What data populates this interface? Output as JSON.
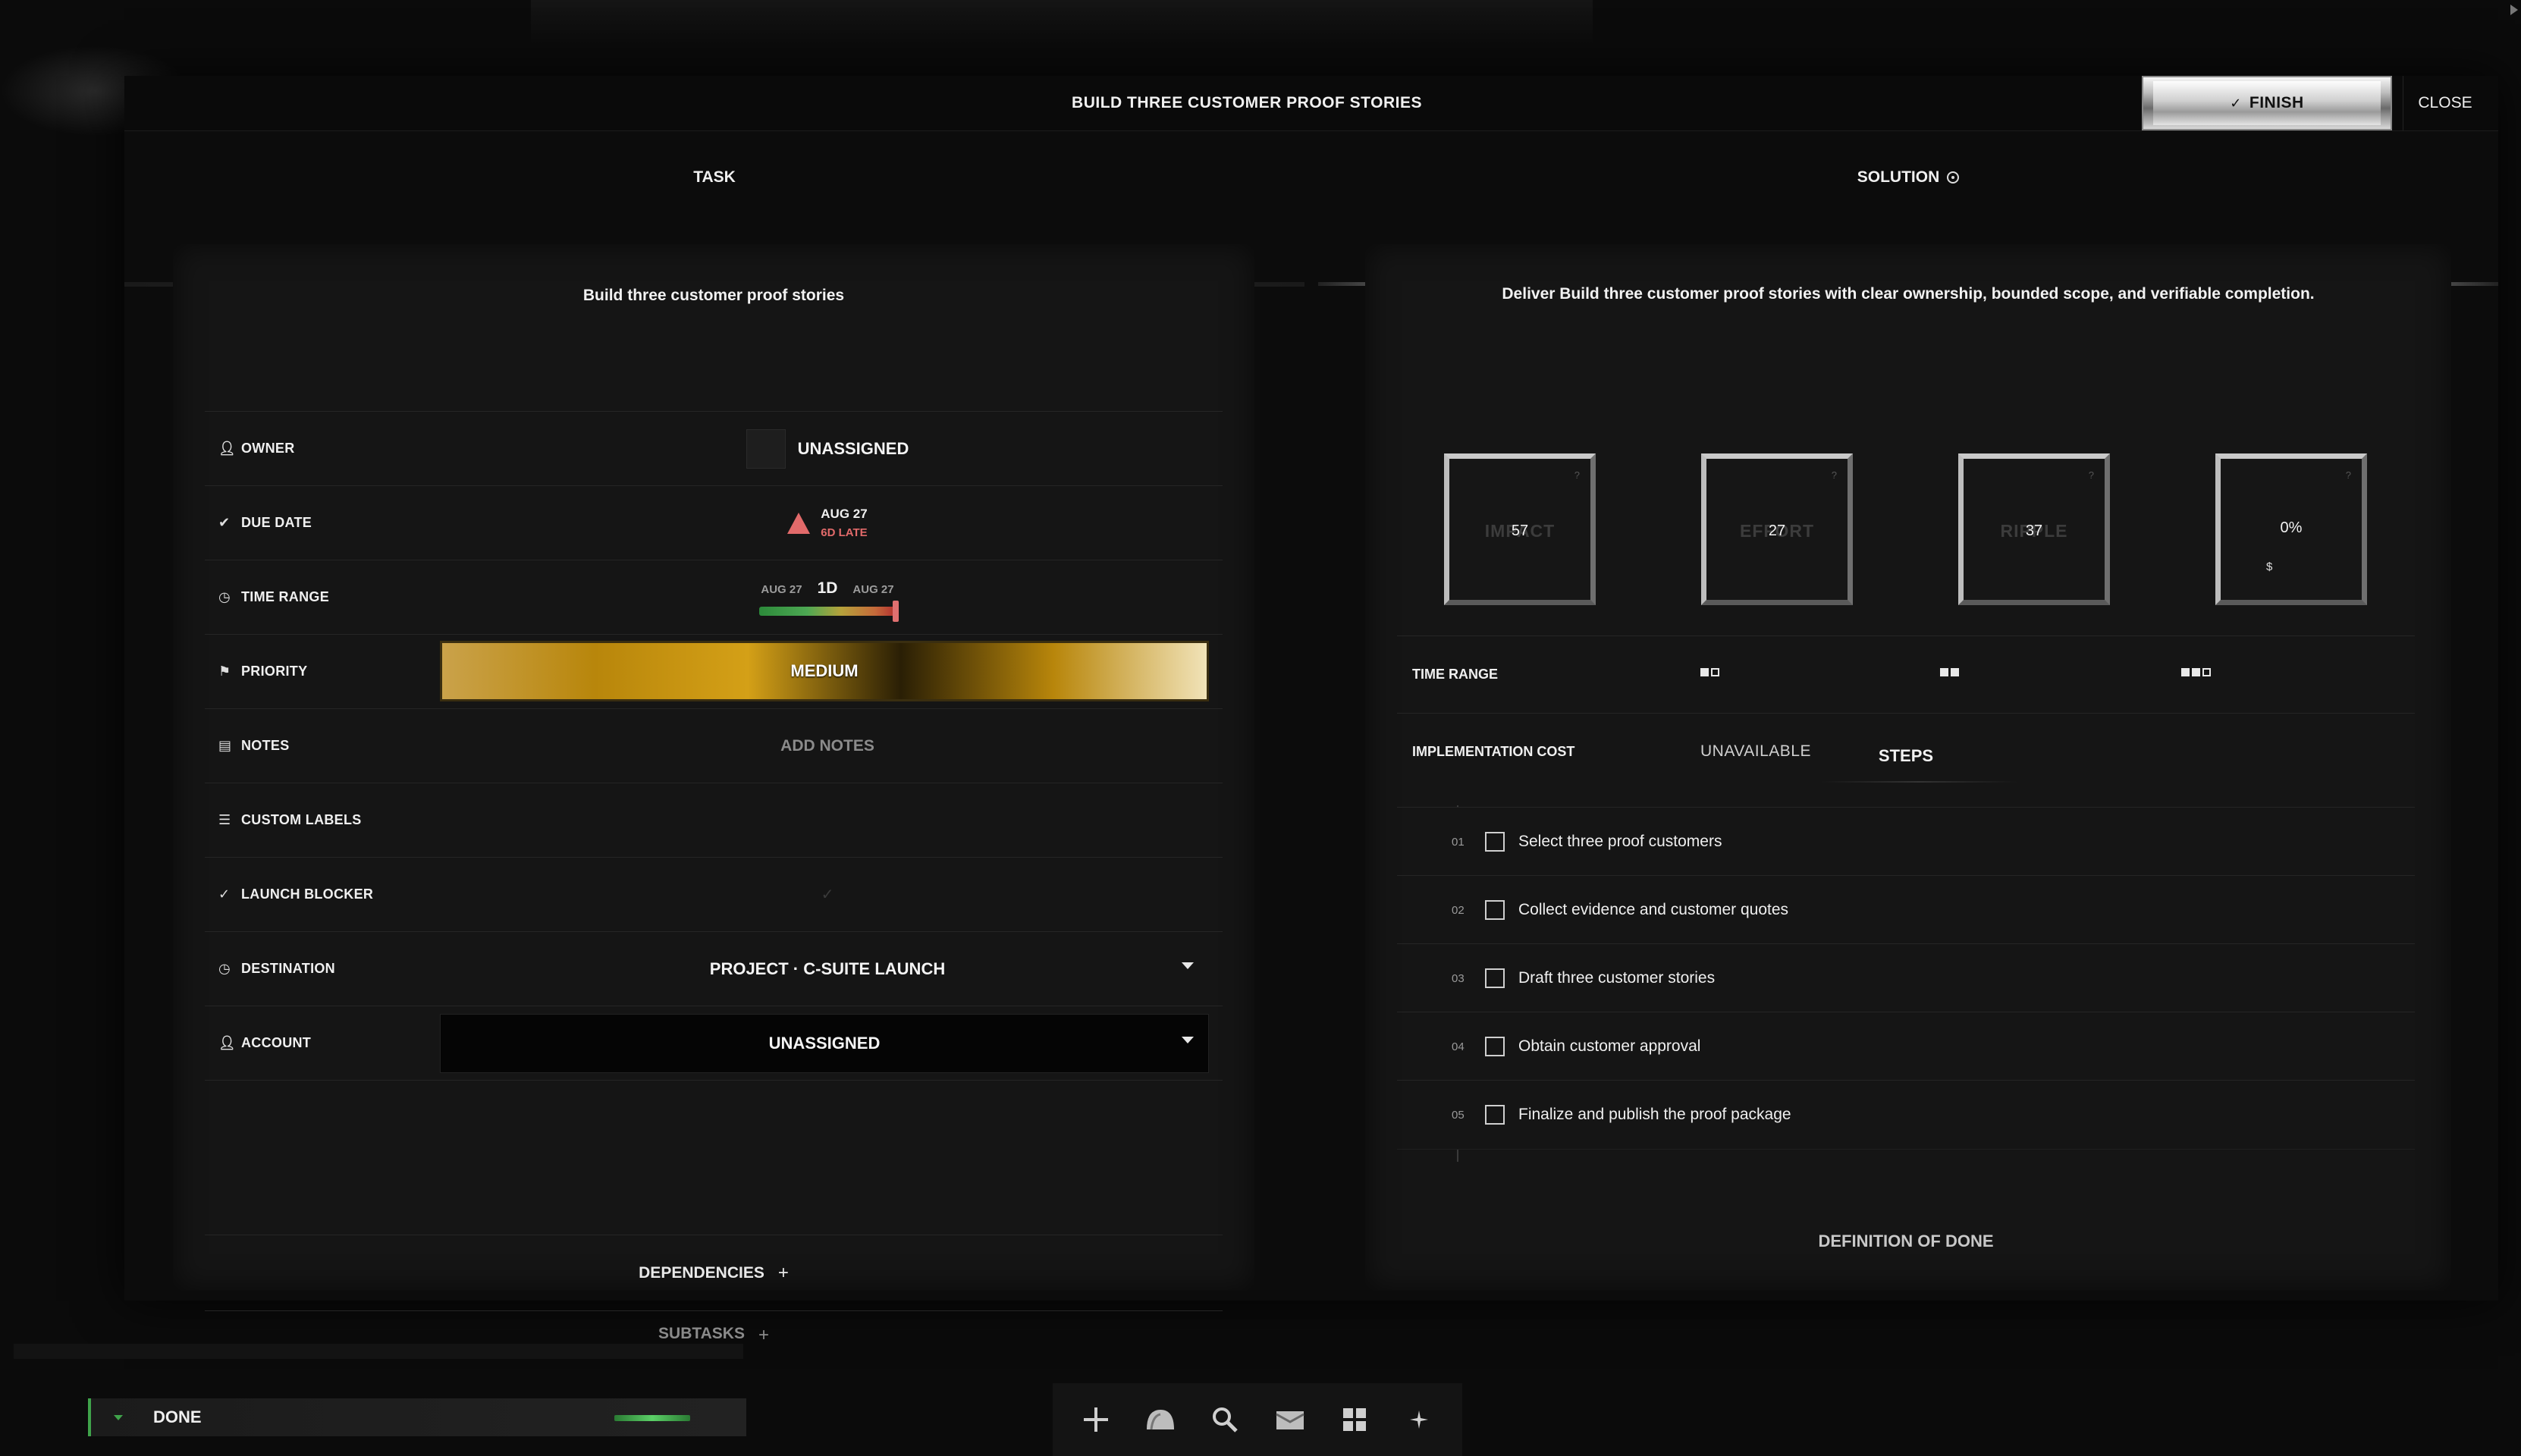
{
  "modal": {
    "title": "BUILD THREE CUSTOMER PROOF STORIES",
    "finish_label": "FINISH",
    "close_label": "CLOSE"
  },
  "tabs": {
    "task": "TASK",
    "solution": "SOLUTION"
  },
  "task": {
    "heading": "Build three customer proof stories",
    "rows": {
      "owner": {
        "label": "OWNER",
        "value": "UNASSIGNED"
      },
      "due_date": {
        "label": "DUE DATE",
        "date": "AUG 27",
        "status": "6D LATE"
      },
      "time_range": {
        "label": "TIME RANGE",
        "start": "AUG 27",
        "duration": "1D",
        "end": "AUG 27"
      },
      "priority": {
        "label": "PRIORITY",
        "value": "MEDIUM"
      },
      "notes": {
        "label": "NOTES",
        "value": "ADD NOTES"
      },
      "custom_labels": {
        "label": "CUSTOM LABELS"
      },
      "launch_blocker": {
        "label": "LAUNCH BLOCKER",
        "value": "✓"
      },
      "destination": {
        "label": "DESTINATION",
        "value": "PROJECT · C-SUITE LAUNCH"
      },
      "account": {
        "label": "ACCOUNT",
        "value": "UNASSIGNED"
      }
    },
    "dependencies_label": "DEPENDENCIES",
    "subtasks_label": "SUBTASKS"
  },
  "solution": {
    "heading": "Deliver Build three customer proof stories with clear ownership, bounded scope, and verifiable completion.",
    "metrics": [
      {
        "ghost": "IMPACT",
        "value": "57"
      },
      {
        "ghost": "EFFORT",
        "value": "27"
      },
      {
        "ghost": "RIPPLE",
        "value": "37"
      },
      {
        "ghost": "",
        "value": "0%",
        "sub": "$"
      }
    ],
    "time_range_label": "TIME RANGE",
    "implementation_cost_label": "IMPLEMENTATION COST",
    "implementation_cost_value": "UNAVAILABLE",
    "steps_label": "STEPS",
    "steps": [
      {
        "num": "01",
        "text": "Select three proof customers"
      },
      {
        "num": "02",
        "text": "Collect evidence and customer quotes"
      },
      {
        "num": "03",
        "text": "Draft three customer stories"
      },
      {
        "num": "04",
        "text": "Obtain customer approval"
      },
      {
        "num": "05",
        "text": "Finalize and publish the proof package"
      }
    ],
    "definition_of_done_label": "DEFINITION OF DONE"
  },
  "bottom": {
    "done_label": "DONE"
  },
  "icons": {
    "dock": [
      "plus-icon",
      "dome-icon",
      "search-icon",
      "cards-icon",
      "grid-icon",
      "sparkle-icon"
    ]
  },
  "colors": {
    "accent_green": "#3fa34a",
    "late_red": "#e26a6a",
    "priority_gold": "#b8860b"
  }
}
